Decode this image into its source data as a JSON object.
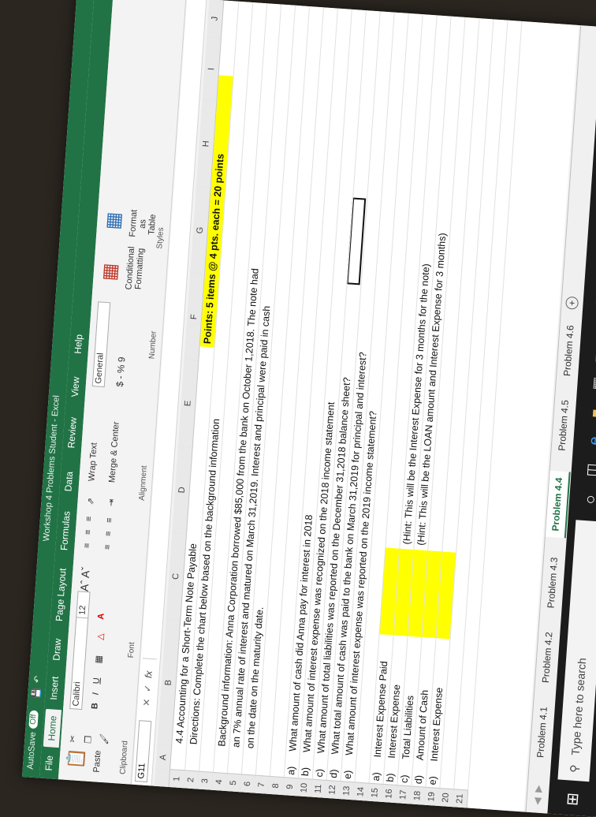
{
  "window": {
    "autosave": "AutoSave",
    "autosave_state": "Off",
    "title": "Workshop 4 Problems Student  -  Excel"
  },
  "ribbon_tabs": [
    "File",
    "Home",
    "Insert",
    "Draw",
    "Page Layout",
    "Formulas",
    "Data",
    "Review",
    "View",
    "Help"
  ],
  "ribbon": {
    "paste": "Paste",
    "clipboard": "Clipboard",
    "font_name": "Calibri",
    "font_size": "12",
    "font_group": "Font",
    "wrap_text": "Wrap Text",
    "merge_center": "Merge & Center",
    "alignment": "Alignment",
    "number_format": "General",
    "number_symbols": "$ - % 9",
    "number_group": "Number",
    "conditional": "Conditional Formatting",
    "format_as_table": "Format as Table",
    "styles": "Styles"
  },
  "formula_bar": {
    "name_box": "G11",
    "fx": "fx",
    "content": ""
  },
  "columns": [
    "A",
    "B",
    "C",
    "D",
    "E",
    "F",
    "G",
    "H",
    "I",
    "J"
  ],
  "rows": [
    {
      "n": "1",
      "a": "",
      "b": "4.4 Accounting for a Short-Term Note Payable",
      "h": "Points: 5 items @ 4 pts. each = 20 points"
    },
    {
      "n": "2",
      "a": "",
      "b": "Directions: Complete the chart below based on the background information"
    },
    {
      "n": "3",
      "a": "",
      "b": ""
    },
    {
      "n": "4",
      "a": "",
      "b": "Background information: Anna Corporation borrowed $85,000 from the bank on October 1,2018.  The note had"
    },
    {
      "n": "5",
      "a": "",
      "b": "an 7% annual rate of interest and matured on March 31,2019.  Interest and principal were paid in cash"
    },
    {
      "n": "6",
      "a": "",
      "b": "on the date on the maturity date."
    },
    {
      "n": "7",
      "a": "",
      "b": ""
    },
    {
      "n": "8",
      "a": "",
      "b": ""
    },
    {
      "n": "9",
      "a": "a)",
      "b": "What amount of cash did Anna pay for interest in 2018"
    },
    {
      "n": "10",
      "a": "b)",
      "b": "What amount of interest expense was recognized on the 2018 income statement"
    },
    {
      "n": "11",
      "a": "c)",
      "b": "What amount of total liabilities was reported on the December 31,2018 balance sheet?"
    },
    {
      "n": "12",
      "a": "d)",
      "b": "What total amount of cash was paid to the bank on March 31,2019 for principal and interest?"
    },
    {
      "n": "13",
      "a": "e)",
      "b": "What amount of interest expense was reported on the 2019 income statement?"
    },
    {
      "n": "14",
      "a": "",
      "b": ""
    },
    {
      "n": "15",
      "a": "a)",
      "b": "Interest Expense Paid",
      "hint": ""
    },
    {
      "n": "16",
      "a": "b)",
      "b": "Interest Expense",
      "hint": "(Hint: This will be the Interest Expense for 3 months for the note)"
    },
    {
      "n": "17",
      "a": "c)",
      "b": "Total Liabilities",
      "hint": "(Hint: This will be the LOAN amount and Interest Expense for 3 months)"
    },
    {
      "n": "18",
      "a": "d)",
      "b": "Amount of Cash",
      "hint": ""
    },
    {
      "n": "19",
      "a": "e)",
      "b": "Interest Expense",
      "hint": ""
    },
    {
      "n": "20",
      "a": "",
      "b": ""
    },
    {
      "n": "21",
      "a": "",
      "b": ""
    }
  ],
  "sheet_tabs": [
    "Problem 4.1",
    "Problem 4.2",
    "Problem 4.3",
    "Problem 4.4",
    "Problem 4.5",
    "Problem 4.6"
  ],
  "active_sheet": "Problem 4.4",
  "taskbar": {
    "search_placeholder": "Type here to search"
  },
  "colors": {
    "excel_green": "#217346",
    "highlight": "#ffff00"
  }
}
